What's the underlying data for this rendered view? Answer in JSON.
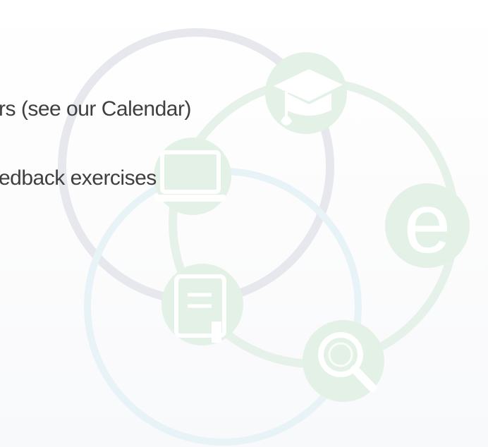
{
  "slide": {
    "bullets": [
      {
        "text": "rs (see our Calendar)"
      },
      {
        "text": "edback exercises"
      }
    ]
  },
  "graphic": {
    "icons": [
      "graduation-cap-icon",
      "laptop-icon",
      "e-letter-icon",
      "document-icon",
      "magnifier-icon"
    ],
    "e_letter": "e"
  },
  "colors": {
    "ring_grey": "#e6e8ee",
    "ring_green": "#e6f2e9",
    "ring_blue": "#e8f3f7",
    "node_green": "#e3f1e6",
    "icon_white": "#ffffff",
    "text": "#3f3f3f"
  }
}
